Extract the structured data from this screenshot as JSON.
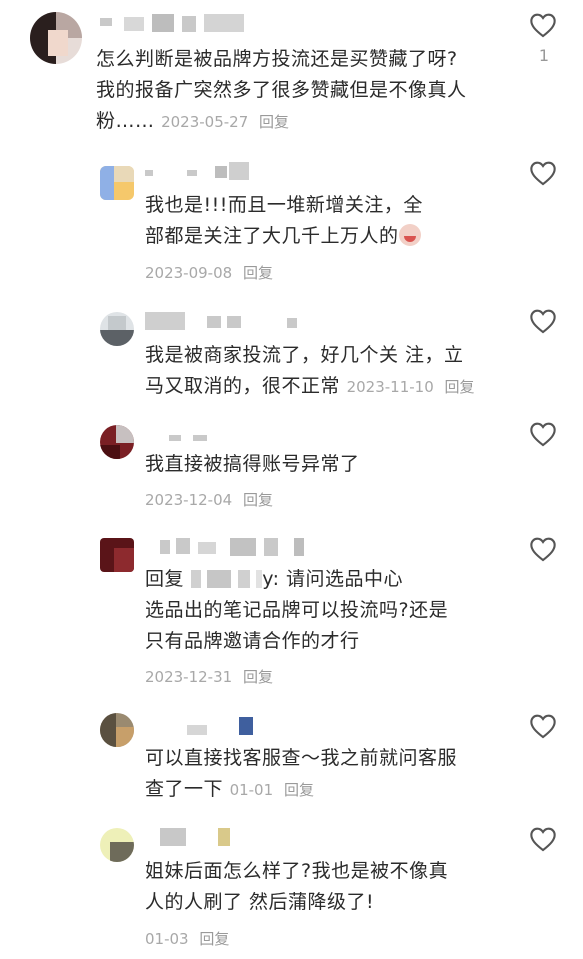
{
  "comments": [
    {
      "text_line1": "怎么判断是被品牌方投流还是买赞藏了呀?",
      "text_line2": "我的报备广突然多了很多赞藏但是不像真人",
      "text_line3": "粉……",
      "date": "2023-05-27",
      "reply_label": "回复",
      "likes": "1"
    },
    {
      "text_line1": "我也是!!!而且一堆新增关注，全",
      "text_line2": "部都是关注了大几千上万人的",
      "emoji": "crying-face-emoji",
      "date": "2023-09-08",
      "reply_label": "回复"
    },
    {
      "text_line1": "我是被商家投流了，好几个关 注，立",
      "text_line2": "马又取消的，很不正常",
      "date": "2023-11-10",
      "reply_label": "回复"
    },
    {
      "text_line1": "我直接被搞得账号异常了",
      "date": "2023-12-04",
      "reply_label": "回复"
    },
    {
      "reply_prefix": "回复",
      "mention_tail": "y:",
      "text_line1": "请问选品中心",
      "text_line2": "选品出的笔记品牌可以投流吗?还是",
      "text_line3": "只有品牌邀请合作的才行",
      "date": "2023-12-31",
      "reply_label": "回复"
    },
    {
      "text_line1": "可以直接找客服查～我之前就问客服",
      "text_line2": "查了一下",
      "date": "01-01",
      "reply_label": "回复"
    },
    {
      "text_line1": "姐妹后面怎么样了?我也是被不像真",
      "text_line2": "人的人刷了 然后蒲降级了!",
      "date": "01-03",
      "reply_label": "回复"
    }
  ],
  "icons": {
    "like": "heart-outline-icon"
  },
  "colors": {
    "text": "#2b2b2b",
    "meta": "#a8a8a8",
    "icon": "#555555"
  }
}
